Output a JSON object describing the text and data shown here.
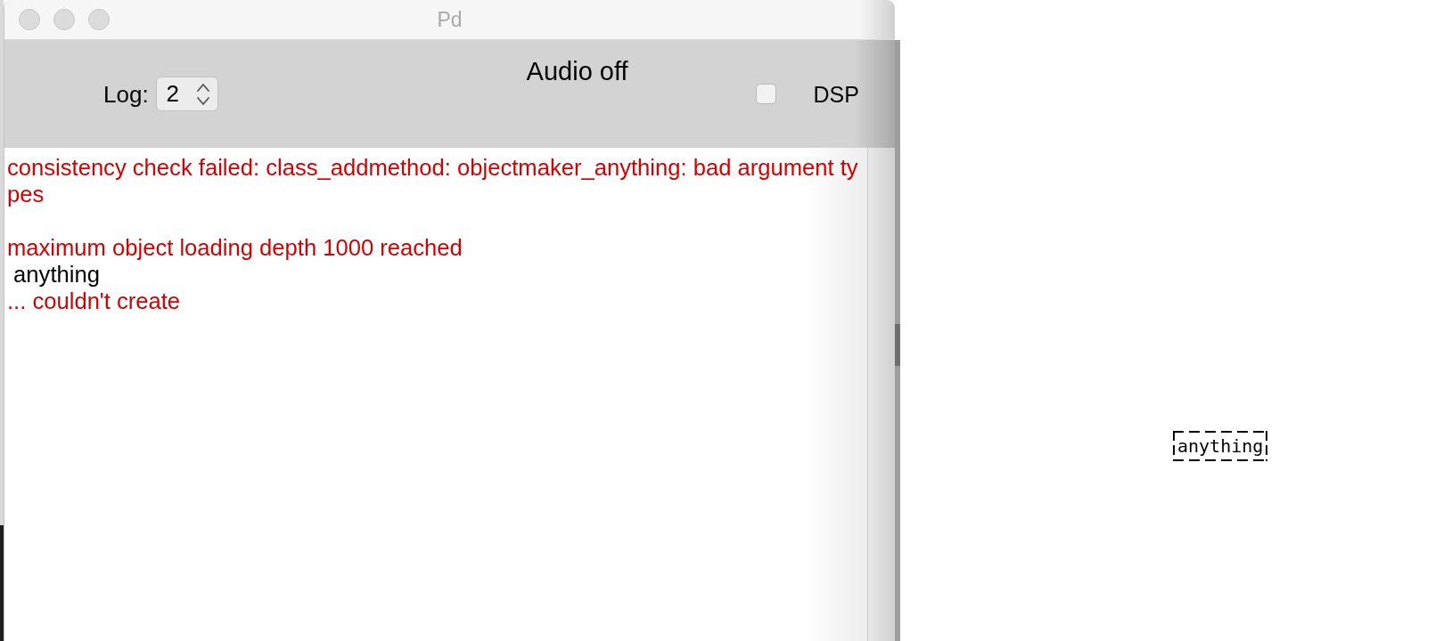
{
  "window": {
    "title": "Pd"
  },
  "toolbar": {
    "log_label": "Log:",
    "log_level": "2",
    "audio_status": "Audio off",
    "dsp": {
      "label": "DSP",
      "checked": false
    }
  },
  "console": {
    "lines": [
      {
        "kind": "error",
        "text": "consistency check failed: class_addmethod: objectmaker_anything: bad argument ty"
      },
      {
        "kind": "error",
        "text": "pes"
      },
      {
        "kind": "blank"
      },
      {
        "kind": "error",
        "text": "maximum object loading depth 1000 reached"
      },
      {
        "kind": "info",
        "text": " anything"
      },
      {
        "kind": "error",
        "text": "... couldn't create"
      }
    ]
  },
  "canvas": {
    "objects": [
      {
        "text": "anything",
        "broken": true
      }
    ]
  }
}
